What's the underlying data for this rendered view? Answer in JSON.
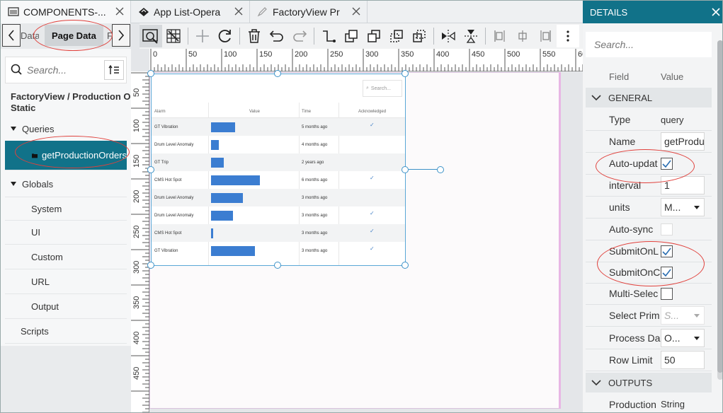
{
  "tabs": [
    {
      "label": "COMPONENTS-..."
    },
    {
      "label": "App List-Opera"
    },
    {
      "label": "FactoryView Pr"
    }
  ],
  "left": {
    "tab_data": "Data",
    "tab_page_data": "Page Data",
    "tab_next": "F",
    "search_placeholder": "Search...",
    "page_title_line1": "FactoryView / Production Orde",
    "page_title_line2": "Static",
    "queries_label": "Queries",
    "query_item": "getProductionOrders",
    "globals_label": "Globals",
    "globals": [
      "System",
      "UI",
      "Custom",
      "URL",
      "Output"
    ],
    "scripts_label": "Scripts"
  },
  "ruler": {
    "h": [
      "0",
      "50",
      "100",
      "150",
      "200",
      "250",
      "300",
      "350",
      "400",
      "450",
      "500",
      "550",
      "60"
    ],
    "v": [
      "50",
      "100",
      "150",
      "200",
      "250",
      "300",
      "350",
      "400",
      "450"
    ]
  },
  "widget": {
    "search_placeholder": "Search...",
    "headers": [
      "Alarm",
      "Value",
      "Time",
      "Acknowledged"
    ],
    "rows": [
      {
        "alarm": "GT Vibration",
        "value": 0.24,
        "time": "5 months ago",
        "ack": true
      },
      {
        "alarm": "Drum Level Anomaly",
        "value": 0.08,
        "time": "4 months ago",
        "ack": false
      },
      {
        "alarm": "GT Trip",
        "value": 0.13,
        "time": "2 years ago",
        "ack": false
      },
      {
        "alarm": "CMS Hot Spot",
        "value": 0.49,
        "time": "6 months ago",
        "ack": true
      },
      {
        "alarm": "Drum Level Anomaly",
        "value": 0.32,
        "time": "3 months ago",
        "ack": false
      },
      {
        "alarm": "Drum Level Anomaly",
        "value": 0.22,
        "time": "3 months ago",
        "ack": true
      },
      {
        "alarm": "CMS Hot Spot",
        "value": 0.02,
        "time": "3 months ago",
        "ack": true
      },
      {
        "alarm": "GT Vibration",
        "value": 0.44,
        "time": "3 months ago",
        "ack": true
      }
    ]
  },
  "details": {
    "title": "DETAILS",
    "search_placeholder": "Search...",
    "col_field": "Field",
    "col_value": "Value",
    "section_general": "GENERAL",
    "section_outputs": "OUTPUTS",
    "type_label": "Type",
    "type_value": "query",
    "name_label": "Name",
    "name_value": "getProdu",
    "auto_update_label": "Auto-updat",
    "auto_update": true,
    "interval_label": "interval",
    "interval_value": "1",
    "units_label": "units",
    "units_value": "M...",
    "auto_sync_label": "Auto-sync",
    "auto_sync": false,
    "submit1_label": "SubmitOnL",
    "submit1": true,
    "submit2_label": "SubmitOnC",
    "submit2": true,
    "multi_select_label": "Multi-Selec",
    "multi_select": false,
    "select_prim_label": "Select Prim",
    "select_prim_value": "S...",
    "process_label": "Process Da",
    "process_value": "O...",
    "row_limit_label": "Row Limit",
    "row_limit_value": "50",
    "output_label": "Production",
    "output_value": "String"
  },
  "colors": {
    "accent": "#117289",
    "bar": "#3b7dd1",
    "annotation": "#e0413c"
  }
}
